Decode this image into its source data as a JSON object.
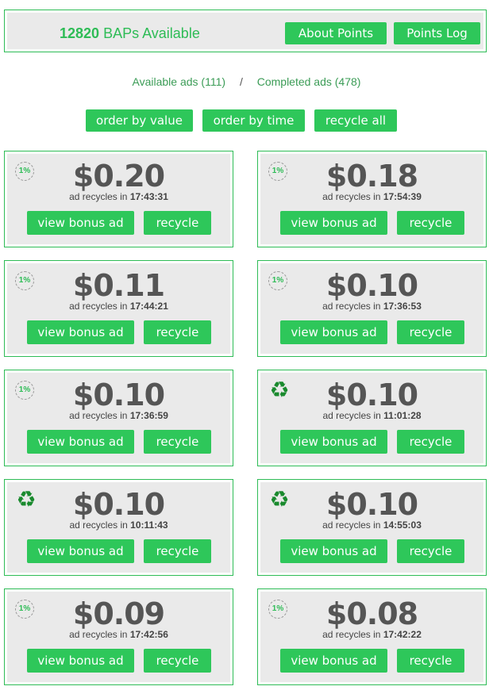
{
  "header": {
    "baps_count": "12820",
    "baps_label": "BAPs Available",
    "about_label": "About Points",
    "log_label": "Points Log"
  },
  "links": {
    "available": "Available ads (111)",
    "separator": "/",
    "completed": "Completed ads (478)"
  },
  "sort": {
    "by_value": "order by value",
    "by_time": "order by time",
    "recycle_all": "recycle all"
  },
  "card_labels": {
    "recycles_prefix": "ad recycles in",
    "view_label": "view bonus ad",
    "recycle_label": "recycle",
    "percent_badge": "1%",
    "recycle_icon": "♻"
  },
  "ads": [
    {
      "amount": "$0.20",
      "time": "17:43:31",
      "badge": "percent-badge-icon"
    },
    {
      "amount": "$0.18",
      "time": "17:54:39",
      "badge": "percent-badge-icon"
    },
    {
      "amount": "$0.11",
      "time": "17:44:21",
      "badge": "percent-badge-icon"
    },
    {
      "amount": "$0.10",
      "time": "17:36:53",
      "badge": "percent-badge-icon"
    },
    {
      "amount": "$0.10",
      "time": "17:36:59",
      "badge": "percent-badge-icon"
    },
    {
      "amount": "$0.10",
      "time": "11:01:28",
      "badge": "recycle-icon"
    },
    {
      "amount": "$0.10",
      "time": "10:11:43",
      "badge": "recycle-icon"
    },
    {
      "amount": "$0.10",
      "time": "14:55:03",
      "badge": "recycle-icon"
    },
    {
      "amount": "$0.09",
      "time": "17:42:56",
      "badge": "percent-badge-icon"
    },
    {
      "amount": "$0.08",
      "time": "17:42:22",
      "badge": "percent-badge-icon"
    }
  ],
  "colors": {
    "accent": "#2ec75a",
    "border": "#2ebc56",
    "panel": "#eaeaea",
    "amount_text": "#555555",
    "recycle_icon": "#1a8a2e"
  }
}
